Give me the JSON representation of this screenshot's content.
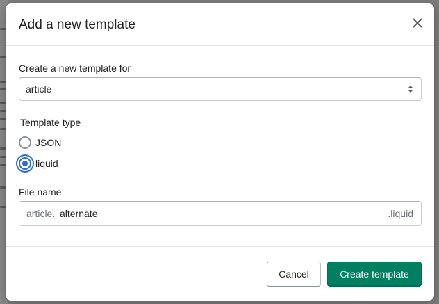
{
  "modal": {
    "title": "Add a new template",
    "close_icon": "close-icon"
  },
  "template_for": {
    "label": "Create a new template for",
    "selected": "article",
    "arrows_icon": "select-arrows-icon"
  },
  "template_type": {
    "label": "Template type",
    "options": [
      {
        "label": "JSON",
        "selected": false
      },
      {
        "label": "liquid",
        "selected": true
      }
    ]
  },
  "file_name": {
    "label": "File name",
    "prefix": "article.",
    "value": "alternate",
    "suffix": ".liquid"
  },
  "footer": {
    "cancel_label": "Cancel",
    "create_label": "Create template"
  },
  "colors": {
    "primary": "#008060",
    "radio_selected": "#2c6ecb",
    "text": "#202223",
    "muted": "#6d7175",
    "border": "#c9cccf"
  }
}
